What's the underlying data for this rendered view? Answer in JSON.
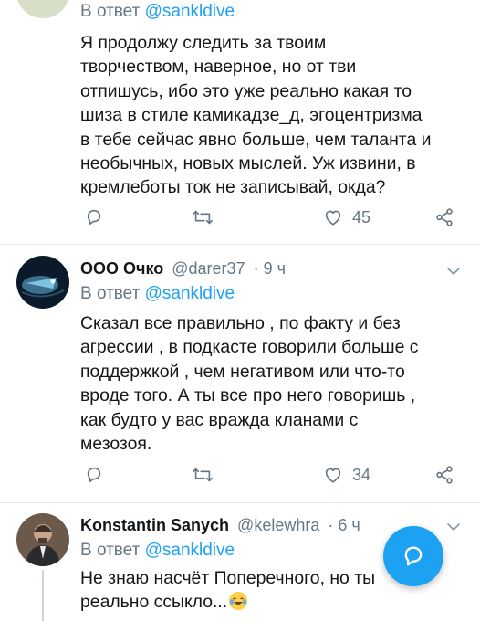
{
  "tweets": [
    {
      "author": "",
      "handle": "",
      "time": "",
      "reply_prefix": "В ответ",
      "reply_handle": "@sankldive",
      "lines": [
        "Я продолжу следить за твоим",
        "творчеством, наверное, но от тви",
        "отпишусь, ибо это уже реально какая то",
        "шиза в стиле камикадзе_д, эгоцентризма",
        "в тебе сейчас явно больше, чем таланта и",
        "необычных, новых мыслей. Уж извини, в",
        "кремлеботы ток не записывай, окда?"
      ],
      "likes": "45"
    },
    {
      "author": "ООО Очко",
      "handle": "@darer37",
      "time": "· 9 ч",
      "reply_prefix": "В ответ",
      "reply_handle": "@sankldive",
      "lines": [
        "Сказал все правильно , по факту и без",
        "агрессии , в подкасте говорили больше с",
        "поддержкой , чем негативом или что-то",
        "вроде того. А ты все про него говоришь ,",
        "как будто у вас вражда кланами с",
        "мезозоя."
      ],
      "likes": "34"
    },
    {
      "author": "Konstantin Sanych",
      "handle": "@kelewhra",
      "time": "· 6 ч",
      "reply_prefix": "В ответ",
      "reply_handle": "@sankldive",
      "lines": [
        "Не знаю насчёт Поперечного, но ты",
        "реально ссыкло..."
      ],
      "emoji": "😂"
    }
  ],
  "icons": {
    "reply": "reply-icon",
    "retweet": "retweet-icon",
    "like": "heart-icon",
    "share": "share-icon",
    "more": "chevron-down-icon",
    "compose": "compose-reply-icon"
  },
  "colors": {
    "accent": "#1da1f2",
    "text": "#14171a",
    "secondary": "#657786",
    "divider": "#e1e8ed"
  }
}
